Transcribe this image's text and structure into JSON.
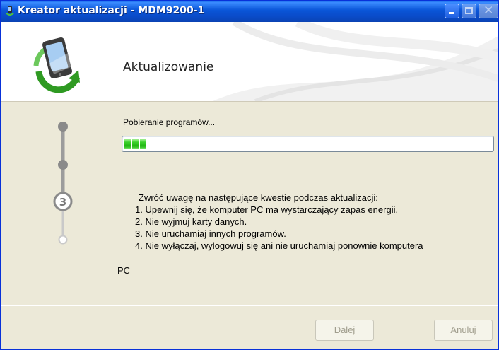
{
  "window": {
    "title": "Kreator aktualizacji - MDM9200-1"
  },
  "header": {
    "title": "Aktualizowanie"
  },
  "stepper": {
    "current_step": "3",
    "total_steps": 4
  },
  "content": {
    "status": "Pobieranie programów...",
    "progress_fraction": 0.06,
    "notes": [
      "Zwróć uwagę na następujące kwestie podczas aktualizacji:",
      "1. Upewnij się, że komputer PC ma wystarczający zapas energii.",
      "2. Nie wyjmuj karty danych.",
      "3. Nie uruchamiaj innych programów.",
      "4. Nie wyłączaj, wylogowuj się ani nie uruchamiaj ponownie komputera"
    ],
    "note_tail": "PC"
  },
  "buttons": {
    "next": "Dalej",
    "cancel": "Anuluj"
  },
  "colors": {
    "titlebar": "#0a55d8",
    "dialog_bg": "#ece9d8",
    "progress_fill": "#1fb512",
    "logo_arrows": "#3cab2a"
  },
  "icons": {
    "title": "update-wizard-icon",
    "logo": "phone-sync-icon"
  }
}
